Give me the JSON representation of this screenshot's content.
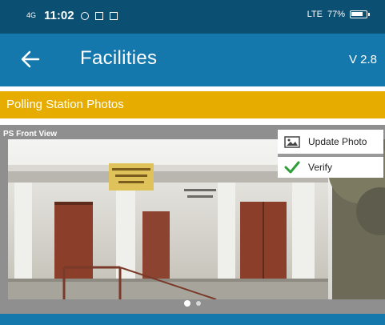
{
  "status_bar": {
    "signal": "4G",
    "time": "11:02",
    "network": "LTE",
    "battery": "77%"
  },
  "app_bar": {
    "title": "Facilities",
    "version": "V 2.8"
  },
  "section": {
    "title": "Polling Station Photos"
  },
  "carousel": {
    "caption": "PS Front View",
    "update_photo_label": "Update Photo",
    "verify_label": "Verify",
    "pages": 2,
    "current_page": 1
  },
  "colors": {
    "status_bar": "#0b4f73",
    "app_bar": "#1478ac",
    "section_header": "#e6ac00",
    "verify_check": "#2e9e3a"
  }
}
